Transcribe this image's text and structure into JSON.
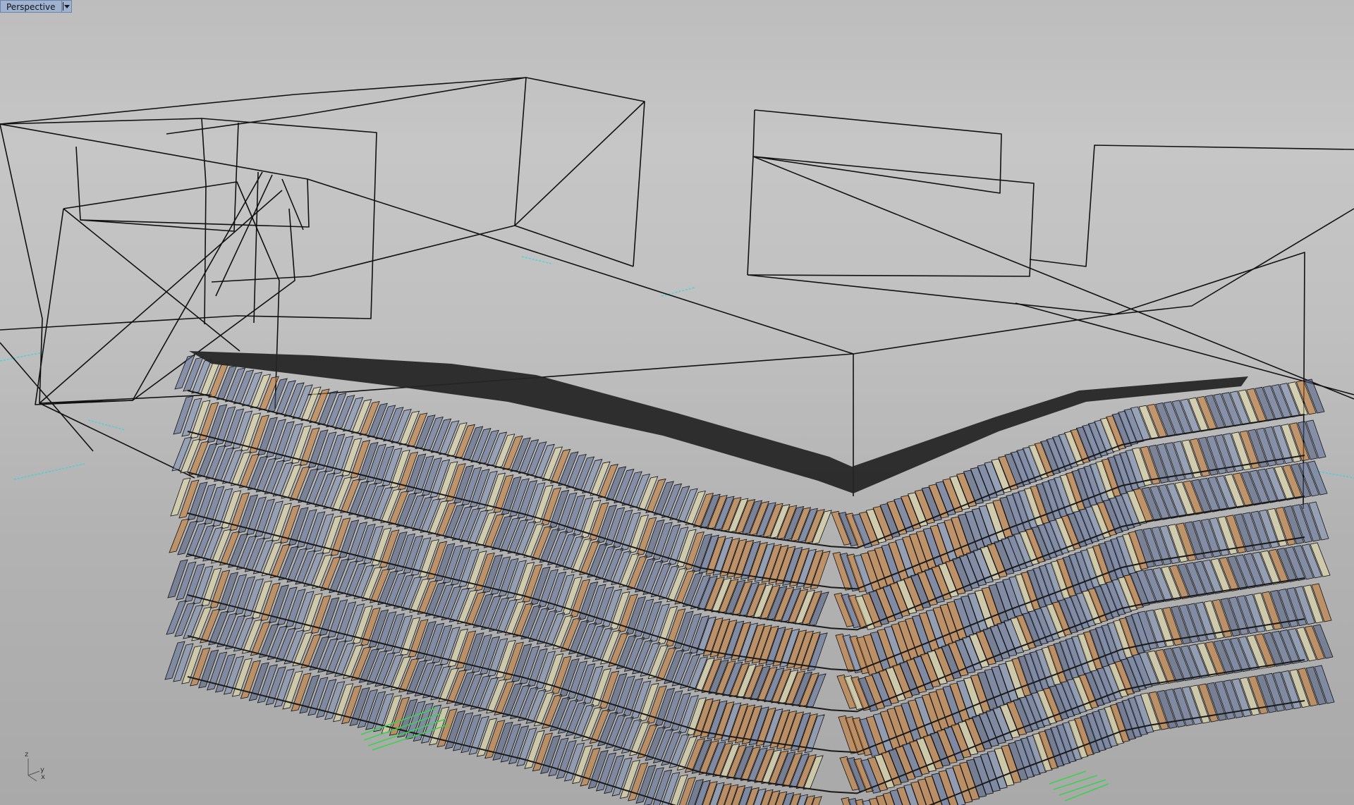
{
  "viewport": {
    "name": "Perspective",
    "axis_labels": {
      "z": "z",
      "y": "y",
      "x": "x"
    }
  },
  "colors": {
    "background_top": "#c6c6c6",
    "background_bottom": "#a9a9a9",
    "tab_fill": "#9fb3d0",
    "wireframe": "#111111",
    "grid_axis_cyan": "#2fd6df",
    "grid_axis_green": "#3bd24b",
    "fin_orange": "#c7782e",
    "fin_blue": "#5b6f9a",
    "fin_cream": "#e9dfaa",
    "roof": "#2b2b2b"
  },
  "icons": [
    "dropdown-arrow-icon",
    "world-axes-icon"
  ]
}
